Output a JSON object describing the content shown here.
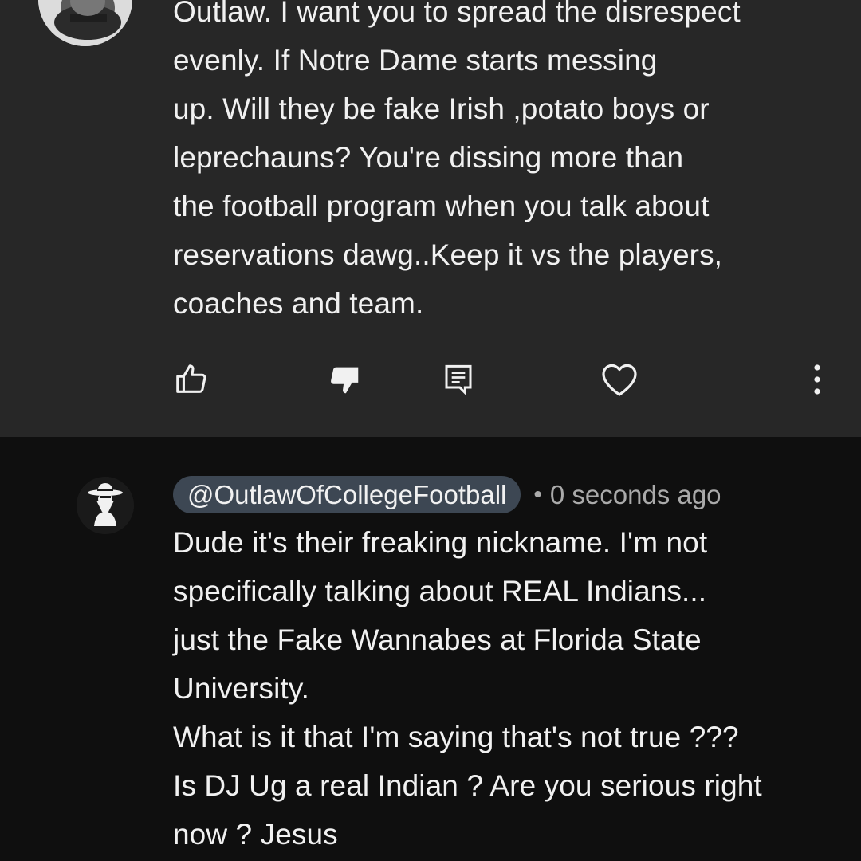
{
  "top_comment": {
    "text": "Outlaw. I want you to spread the disrespect\nevenly. If Notre Dame starts messing\nup. Will they be fake Irish ,potato boys or\nleprechauns? You're dissing more than\nthe football program when you talk about\nreservations dawg..Keep it vs the players,\ncoaches and team.",
    "actions": {
      "like": "thumbs-up-icon",
      "dislike": "thumbs-down-icon",
      "reply": "reply-icon",
      "heart": "heart-icon",
      "more": "more-vertical-icon"
    }
  },
  "reply_comment": {
    "handle": "@OutlawOfCollegeFootball",
    "separator": "•",
    "timestamp": "0 seconds ago",
    "text": "Dude it's their freaking nickname. I'm not\nspecifically talking about REAL Indians...\njust the Fake Wannabes at Florida State\nUniversity.\nWhat is it that I'm saying that's not true ???\nIs DJ Ug a real Indian ? Are you serious right\nnow ? Jesus"
  },
  "colors": {
    "highlight_bg": "#272727",
    "page_bg": "#0f0f0f",
    "handle_pill_bg": "#3d4753",
    "text_primary": "#f1f1f1",
    "text_secondary": "#aaaaaa"
  }
}
